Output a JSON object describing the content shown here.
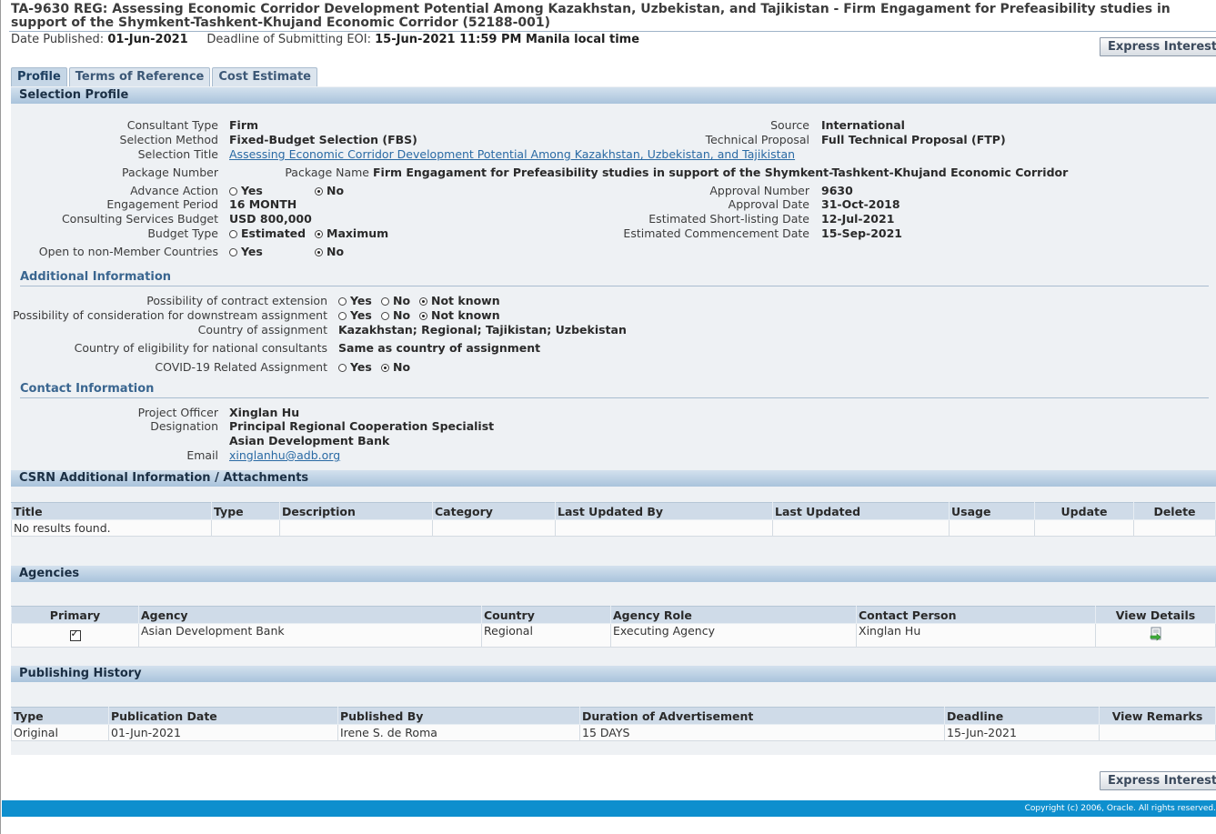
{
  "header": {
    "title": "TA-9630 REG: Assessing Economic Corridor Development Potential Among Kazakhstan, Uzbekistan, and Tajikistan - Firm Engagament for Prefeasibility studies in support of the Shymkent-Tashkent-Khujand Economic Corridor (52188-001)",
    "date_published_label": "Date Published:",
    "date_published": "01-Jun-2021",
    "deadline_label": "Deadline of Submitting EOI:",
    "deadline": "15-Jun-2021 11:59 PM Manila local time",
    "express_interest": "Express Interest"
  },
  "tabs": [
    "Profile",
    "Terms of Reference",
    "Cost Estimate"
  ],
  "selection_profile": {
    "heading": "Selection Profile",
    "consultant_type_label": "Consultant Type",
    "consultant_type": "Firm",
    "selection_method_label": "Selection Method",
    "selection_method": "Fixed-Budget Selection (FBS)",
    "selection_title_label": "Selection Title",
    "selection_title": "Assessing Economic Corridor Development Potential Among Kazakhstan, Uzbekistan, and Tajikistan",
    "package_number_label": "Package Number",
    "package_name_label": "Package Name",
    "package_name": "Firm Engagament for Prefeasibility studies in support of the Shymkent-Tashkent-Khujand Economic Corridor",
    "advance_action_label": "Advance Action",
    "engagement_period_label": "Engagement Period",
    "engagement_period": "16 MONTH",
    "budget_label": "Consulting Services Budget",
    "budget": "USD 800,000",
    "budget_type_label": "Budget Type",
    "budget_type_estimated": "Estimated",
    "budget_type_maximum": "Maximum",
    "open_nonmember_label": "Open to non-Member Countries",
    "yes": "Yes",
    "no": "No",
    "source_label": "Source",
    "source": "International",
    "technical_proposal_label": "Technical Proposal",
    "technical_proposal": "Full Technical Proposal (FTP)",
    "approval_number_label": "Approval Number",
    "approval_number": "9630",
    "approval_date_label": "Approval Date",
    "approval_date": "31-Oct-2018",
    "shortlisting_label": "Estimated Short-listing Date",
    "shortlisting": "12-Jul-2021",
    "commencement_label": "Estimated Commencement Date",
    "commencement": "15-Sep-2021"
  },
  "additional_info": {
    "heading": "Additional Information",
    "extension_label": "Possibility of contract extension",
    "downstream_label": "Possibility of consideration for downstream assignment",
    "country_assignment_label": "Country of assignment",
    "country_assignment": "Kazakhstan; Regional; Tajikistan; Uzbekistan",
    "eligibility_label": "Country of eligibility for national consultants",
    "eligibility": "Same as country of assignment",
    "covid_label": "COVID-19 Related Assignment",
    "yes": "Yes",
    "no": "No",
    "not_known": "Not known"
  },
  "contact_info": {
    "heading": "Contact Information",
    "officer_label": "Project Officer",
    "officer": "Xinglan Hu",
    "designation_label": "Designation",
    "designation": "Principal Regional Cooperation Specialist",
    "organization": "Asian Development Bank",
    "email_label": "Email",
    "email": "xinglanhu@adb.org"
  },
  "csrn": {
    "heading": "CSRN Additional Information / Attachments",
    "columns": [
      "Title",
      "Type",
      "Description",
      "Category",
      "Last Updated By",
      "Last Updated",
      "Usage",
      "Update",
      "Delete"
    ],
    "empty": "No results found."
  },
  "agencies": {
    "heading": "Agencies",
    "columns": [
      "Primary",
      "Agency",
      "Country",
      "Agency Role",
      "Contact Person",
      "View Details"
    ],
    "rows": [
      {
        "agency": "Asian Development Bank",
        "country": "Regional",
        "role": "Executing Agency",
        "contact": "Xinglan Hu"
      }
    ]
  },
  "publishing": {
    "heading": "Publishing History",
    "columns": [
      "Type",
      "Publication Date",
      "Published By",
      "Duration of Advertisement",
      "Deadline",
      "View Remarks"
    ],
    "rows": [
      {
        "type": "Original",
        "date": "01-Jun-2021",
        "by": "Irene S. de Roma",
        "duration": "15 DAYS",
        "deadline": "15-Jun-2021"
      }
    ]
  },
  "footer": {
    "copyright": "Copyright (c) 2006, Oracle. All rights reserved."
  }
}
